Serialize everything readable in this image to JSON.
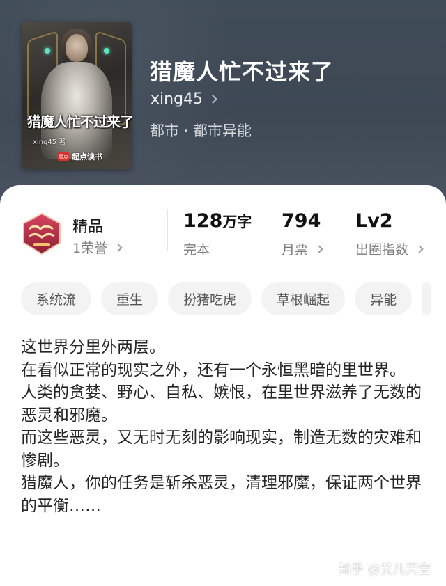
{
  "book": {
    "title": "猎魔人忙不过来了",
    "author": "xing45",
    "genre": "都市 · 都市异能"
  },
  "cover": {
    "title_text": "猎魔人忙不过来了",
    "author_text": "xing45 著",
    "publisher_badge": "起点",
    "publisher_text": "起点读书"
  },
  "stats": {
    "badge_label": "精品",
    "badge_sub": "1荣誉",
    "word_count_value": "128",
    "word_count_unit": "万字",
    "word_count_sub": "完本",
    "monthly_ticket_value": "794",
    "monthly_ticket_sub": "月票",
    "popularity_value": "Lv2",
    "popularity_sub": "出圈指数"
  },
  "tags": [
    "系统流",
    "重生",
    "扮猪吃虎",
    "草根崛起",
    "异能"
  ],
  "description": [
    "这世界分里外两层。",
    "在看似正常的现实之外，还有一个永恒黑暗的里世界。",
    "人类的贪婪、野心、自私、嫉恨，在里世界滋养了无数的恶灵和邪魔。",
    "而这些恶灵，又无时无刻的影响现实，制造无数的灾难和惨剧。",
    "猎魔人，你的任务是斩杀恶灵，清理邪魔，保证两个世界的平衡……"
  ],
  "watermark": "知乎 @艾儿天空",
  "colors": {
    "header_bg": "#404a57",
    "card_bg": "#ffffff",
    "tag_bg": "#f3f3f3",
    "badge_red": "#b3263a"
  }
}
